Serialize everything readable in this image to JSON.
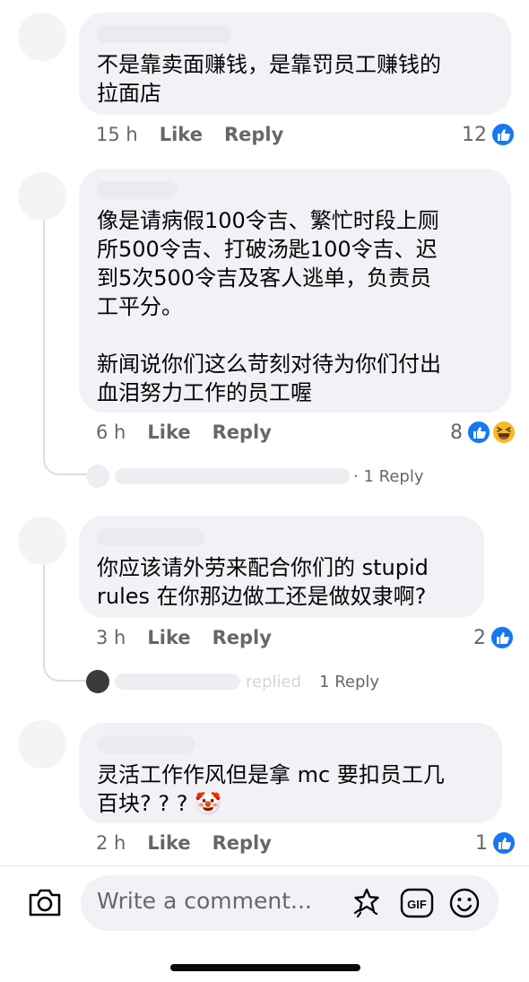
{
  "comments": [
    {
      "text": "不是靠卖面赚钱，是靠罚员工赚钱的\n拉面店",
      "time": "15 h",
      "like": "Like",
      "reply": "Reply",
      "reaction_count": "12"
    },
    {
      "text": "像是请病假100令吉、繁忙时段上厕\n所500令吉、打破汤匙100令吉、迟\n到5次500令吉及客人逃单，负责员\n工平分。\n\n新闻说你们这么苛刻对待为你们付出\n血泪努力工作的员工喔",
      "time": "6 h",
      "like": "Like",
      "reply": "Reply",
      "reaction_count": "8",
      "replies_label": "· 1 Reply"
    },
    {
      "text": "你应该请外劳来配合你们的 stupid\nrules 在你那边做工还是做奴隶啊?",
      "time": "3 h",
      "like": "Like",
      "reply": "Reply",
      "reaction_count": "2",
      "replies_label": "1 Reply",
      "replied_word": "replied"
    },
    {
      "text": "灵活工作作风但是拿 mc 要扣员工几\n百块? ? ?",
      "emoji": "🤡",
      "time": "2 h",
      "like": "Like",
      "reply": "Reply",
      "reaction_count": "1"
    }
  ],
  "composer": {
    "placeholder": "Write a comment..."
  },
  "colors": {
    "like_blue": "#1877f2",
    "haha_yellow": "#f7b928",
    "bubble_bg": "#f0f2f5",
    "meta_gray": "#65676b"
  },
  "icons": {
    "camera": "camera-icon",
    "sticker": "sticker-icon",
    "gif": "gif-icon",
    "emoji": "emoji-icon",
    "like_reaction": "like-reaction-icon",
    "haha_reaction": "haha-reaction-icon"
  }
}
